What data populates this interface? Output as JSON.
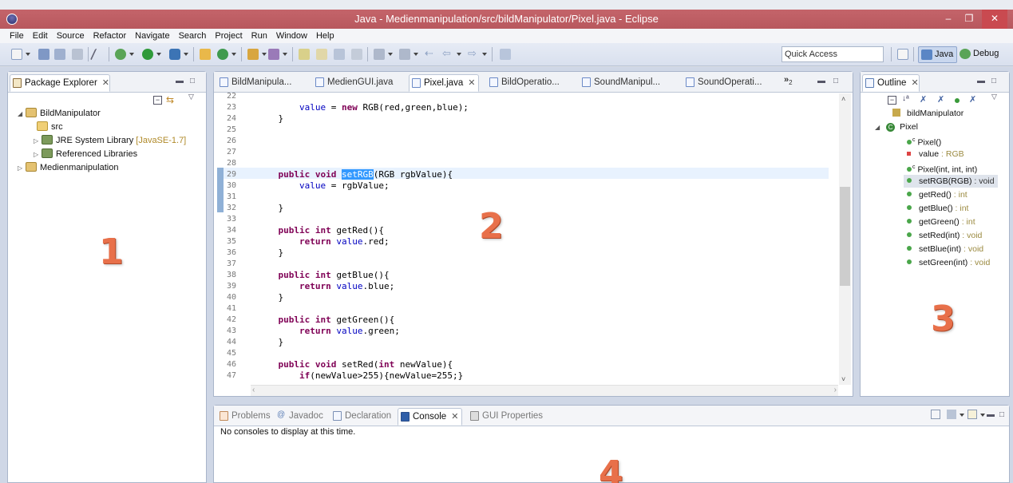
{
  "window": {
    "title": "Java - Medienmanipulation/src/bildManipulator/Pixel.java - Eclipse"
  },
  "menu": [
    "File",
    "Edit",
    "Source",
    "Refactor",
    "Navigate",
    "Search",
    "Project",
    "Run",
    "Window",
    "Help"
  ],
  "toolbar": {
    "quick_access_placeholder": "Quick Access",
    "perspectives": [
      "Java",
      "Debug"
    ]
  },
  "package_explorer": {
    "tab_label": "Package Explorer",
    "marker": "1",
    "tree": [
      {
        "label": "BildManipulator",
        "depth": 0,
        "expanded": true
      },
      {
        "label": "src",
        "depth": 1
      },
      {
        "label": "JRE System Library",
        "suffix": "[JavaSE-1.7]",
        "depth": 1
      },
      {
        "label": "Referenced Libraries",
        "depth": 1
      },
      {
        "label": "Medienmanipulation",
        "depth": 0,
        "expanded": false
      }
    ]
  },
  "editor": {
    "marker": "2",
    "overflow_count": "2",
    "tabs": [
      "BildManipula...",
      "MedienGUI.java",
      "Pixel.java",
      "BildOperatio...",
      "SoundManipul...",
      "SoundOperati..."
    ],
    "active_tab": "Pixel.java",
    "lines": [
      {
        "n": "22",
        "code": ""
      },
      {
        "n": "23",
        "code": "        value = new RGB(red,green,blue);"
      },
      {
        "n": "24",
        "code": "    }"
      },
      {
        "n": "25",
        "code": ""
      },
      {
        "n": "26",
        "code": ""
      },
      {
        "n": "27",
        "code": ""
      },
      {
        "n": "28",
        "code": ""
      },
      {
        "n": "29",
        "code": "    public void setRGB(RGB rgbValue){"
      },
      {
        "n": "30",
        "code": "        value = rgbValue;"
      },
      {
        "n": "31",
        "code": ""
      },
      {
        "n": "32",
        "code": "    }"
      },
      {
        "n": "33",
        "code": ""
      },
      {
        "n": "34",
        "code": "    public int getRed(){"
      },
      {
        "n": "35",
        "code": "        return value.red;"
      },
      {
        "n": "36",
        "code": "    }"
      },
      {
        "n": "37",
        "code": ""
      },
      {
        "n": "38",
        "code": "    public int getBlue(){"
      },
      {
        "n": "39",
        "code": "        return value.blue;"
      },
      {
        "n": "40",
        "code": "    }"
      },
      {
        "n": "41",
        "code": ""
      },
      {
        "n": "42",
        "code": "    public int getGreen(){"
      },
      {
        "n": "43",
        "code": "        return value.green;"
      },
      {
        "n": "44",
        "code": "    }"
      },
      {
        "n": "45",
        "code": ""
      },
      {
        "n": "46",
        "code": "    public void setRed(int newValue){"
      },
      {
        "n": "47",
        "code": "        if(newValue>255){newValue=255;}"
      }
    ]
  },
  "outline": {
    "tab_label": "Outline",
    "marker": "3",
    "package": "bildManipulator",
    "class": "Pixel",
    "members": [
      {
        "name": "Pixel()",
        "type": "",
        "kind": "constructor"
      },
      {
        "name": "value",
        "type": " : RGB",
        "kind": "field"
      },
      {
        "name": "Pixel(int, int, int)",
        "type": "",
        "kind": "constructor"
      },
      {
        "name": "setRGB(RGB)",
        "type": " : void",
        "kind": "method",
        "selected": true
      },
      {
        "name": "getRed()",
        "type": " : int",
        "kind": "method"
      },
      {
        "name": "getBlue()",
        "type": " : int",
        "kind": "method"
      },
      {
        "name": "getGreen()",
        "type": " : int",
        "kind": "method"
      },
      {
        "name": "setRed(int)",
        "type": " : void",
        "kind": "method"
      },
      {
        "name": "setBlue(int)",
        "type": " : void",
        "kind": "method"
      },
      {
        "name": "setGreen(int)",
        "type": " : void",
        "kind": "method"
      }
    ]
  },
  "bottom": {
    "marker": "4",
    "tabs": [
      "Problems",
      "Javadoc",
      "Declaration",
      "Console",
      "GUI Properties"
    ],
    "active_tab": "Console",
    "message": "No consoles to display at this time."
  },
  "colors": {
    "titlebar": "#b8585e",
    "marker": "#e8704a",
    "keyword": "#7f0055",
    "field": "#0000c0",
    "selection": "#3399ff"
  }
}
